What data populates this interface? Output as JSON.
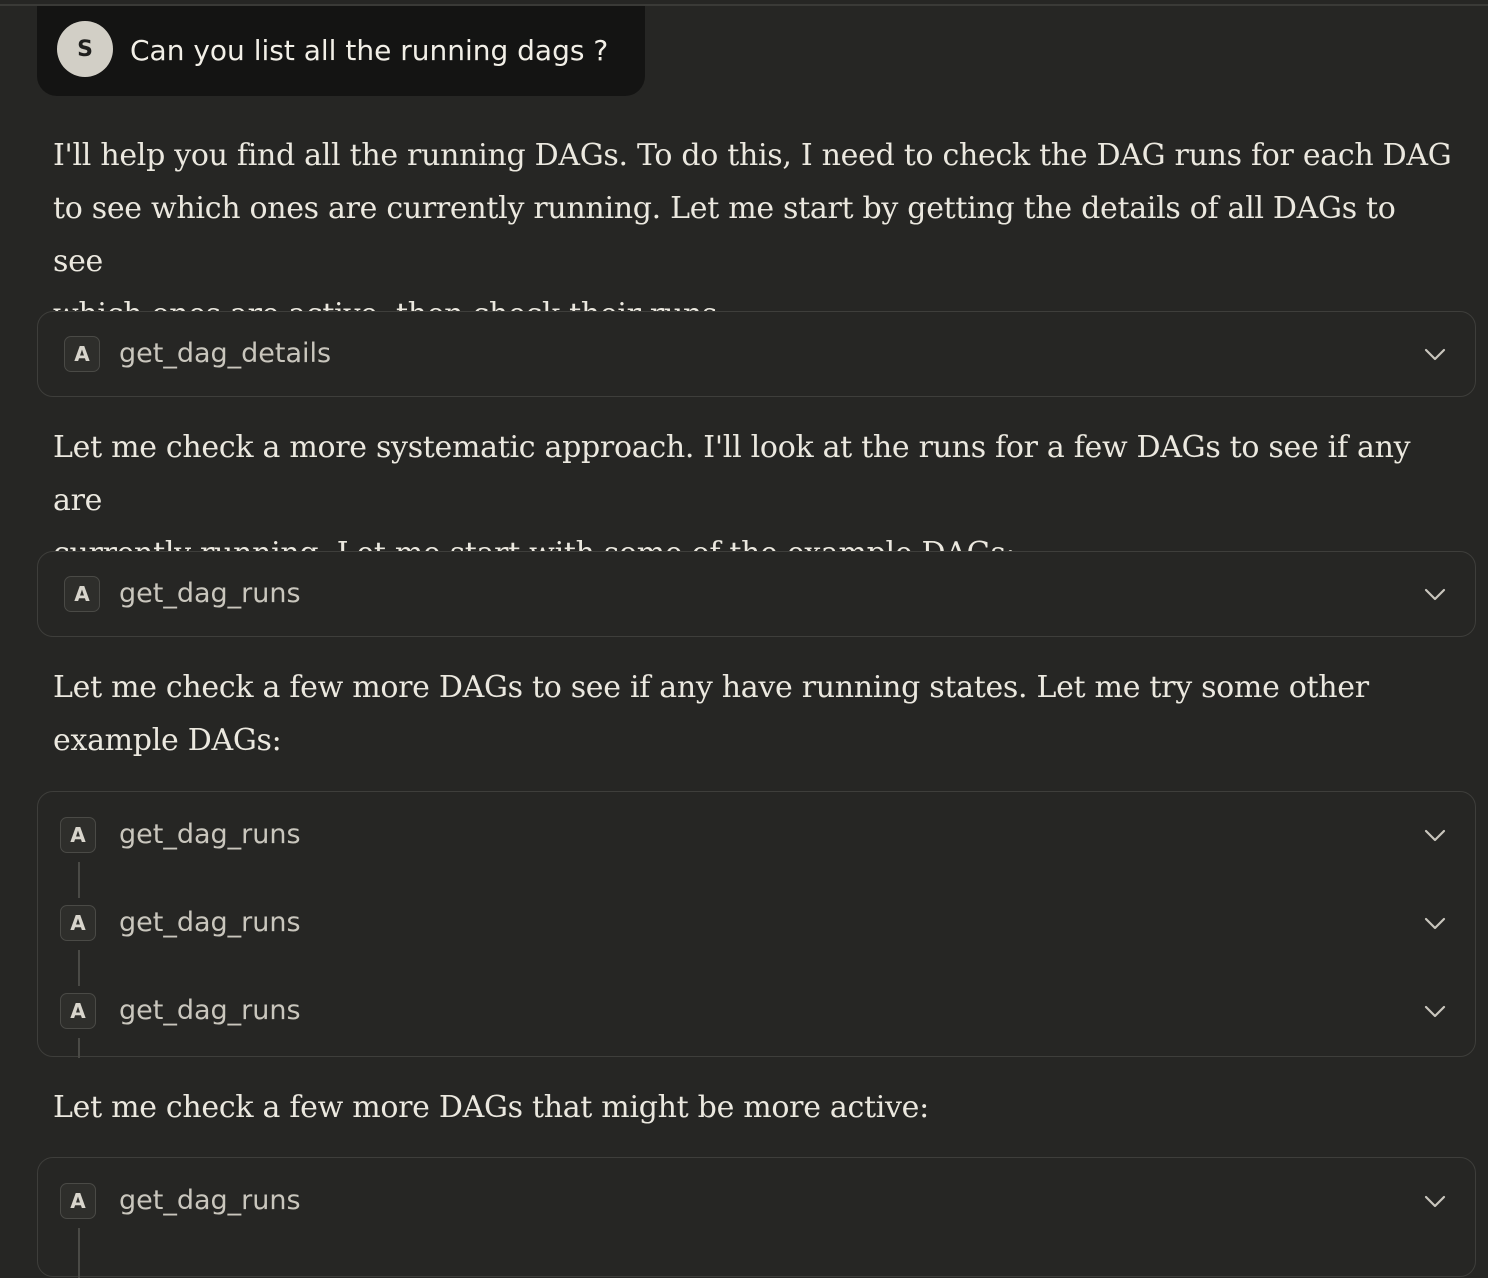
{
  "user_message": {
    "avatar_initial": "S",
    "text": "Can you list all the running dags ?"
  },
  "paragraphs": [
    [
      "I'll help you find all the running DAGs. To do this, I need to check the DAG runs for each DAG",
      "to see which ones are currently running. Let me start by getting the details of all DAGs to see",
      "which ones are active, then check their runs."
    ],
    [
      "Let me check a more systematic approach. I'll look at the runs for a few DAGs to see if any are",
      "currently running. Let me start with some of the example DAGs:"
    ],
    [
      "Let me check a few more DAGs to see if any have running states. Let me try some other",
      "example DAGs:"
    ],
    [
      "Let me check a few more DAGs that might be more active:"
    ]
  ],
  "tool_groups": [
    {
      "calls": [
        {
          "badge": "A",
          "name": "get_dag_details",
          "icon": "chevron-down-icon"
        }
      ]
    },
    {
      "calls": [
        {
          "badge": "A",
          "name": "get_dag_runs",
          "icon": "chevron-down-icon"
        }
      ]
    },
    {
      "calls": [
        {
          "badge": "A",
          "name": "get_dag_runs",
          "icon": "chevron-down-icon"
        },
        {
          "badge": "A",
          "name": "get_dag_runs",
          "icon": "chevron-down-icon"
        },
        {
          "badge": "A",
          "name": "get_dag_runs",
          "icon": "chevron-down-icon"
        }
      ]
    },
    {
      "calls": [
        {
          "badge": "A",
          "name": "get_dag_runs",
          "icon": "chevron-down-icon"
        }
      ]
    }
  ]
}
